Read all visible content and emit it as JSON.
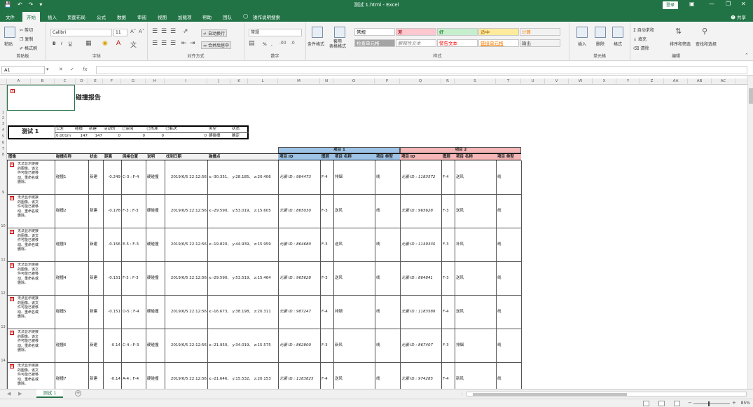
{
  "titlebar": {
    "title": "测试 1.html  -  Excel",
    "login": "登录",
    "undo_icon": "undo-icon",
    "redo_icon": "redo-icon",
    "save_icon": "save-icon"
  },
  "tabs": {
    "items": [
      "文件",
      "开始",
      "插入",
      "页面布局",
      "公式",
      "数据",
      "审阅",
      "视图",
      "加载项",
      "帮助",
      "团队"
    ],
    "tell_me": "操作说明搜索",
    "share": "共享"
  },
  "ribbon": {
    "clipboard": {
      "paste": "粘贴",
      "cut": "剪切",
      "copy": "复制",
      "format_painter": "格式刷",
      "label": "剪贴板"
    },
    "font": {
      "name": "Calibri",
      "size": "11",
      "label": "字体",
      "bold": "B",
      "italic": "I",
      "underline": "U"
    },
    "align": {
      "wrap": "自动换行",
      "merge": "合并后居中",
      "label": "对齐方式"
    },
    "number": {
      "format": "常规",
      "percent": "%",
      "comma": ",",
      "label": "数字"
    },
    "styles": {
      "conditional": "条件格式",
      "table": "套用\n表格格式",
      "label": "样式",
      "cells": [
        {
          "text": "常规",
          "bg": "#ffffff",
          "color": "#000000"
        },
        {
          "text": "差",
          "bg": "#ffc7ce",
          "color": "#9c0006"
        },
        {
          "text": "好",
          "bg": "#c6efce",
          "color": "#006100"
        },
        {
          "text": "适中",
          "bg": "#ffeb9c",
          "color": "#9c5700"
        },
        {
          "text": "计算",
          "bg": "#f2f2f2",
          "color": "#fa7d00"
        },
        {
          "text": "检查单元格",
          "bg": "#a5a5a5",
          "color": "#ffffff"
        },
        {
          "text": "解释性文本",
          "bg": "#ffffff",
          "color": "#7f7f7f"
        },
        {
          "text": "警告文本",
          "bg": "#ffffff",
          "color": "#ff0000"
        },
        {
          "text": "链接单元格",
          "bg": "#ffffff",
          "color": "#fa7d00"
        },
        {
          "text": "输出",
          "bg": "#f2f2f2",
          "color": "#3f3f3f"
        }
      ]
    },
    "cells_group": {
      "insert": "插入",
      "delete": "删除",
      "format": "格式",
      "label": "单元格"
    },
    "editing": {
      "autosum": "自动求和",
      "fill": "填充",
      "clear": "清除",
      "sort": "排序和筛选",
      "find": "查找和选择",
      "label": "编辑"
    }
  },
  "formula_bar": {
    "namebox": "A1",
    "fx": "fx",
    "value": ""
  },
  "columns": [
    "A",
    "B",
    "C",
    "D",
    "E",
    "F",
    "G",
    "H",
    "I",
    "J",
    "K",
    "L",
    "M",
    "N",
    "O",
    "P",
    "Q",
    "R",
    "S",
    "T",
    "U",
    "V",
    "W",
    "X",
    "Y",
    "Z",
    "AA",
    "AB",
    "AC"
  ],
  "rows": [
    "1",
    "2",
    "3",
    "4",
    "5",
    "6",
    "7",
    "8",
    "9",
    "10",
    "11",
    "12",
    "13",
    "14"
  ],
  "sheet": {
    "report_title": "碰撞报告",
    "summary": {
      "name": "测试 1",
      "headers": [
        "公差",
        "碰撞",
        "新建",
        "活动的",
        "已审阅",
        "已核准",
        "已解决",
        "类型",
        "状态"
      ],
      "values": [
        "0.001m",
        "147",
        "147",
        "0",
        "0",
        "0",
        "0",
        "硬碰撞",
        "确定"
      ]
    },
    "item1_title": "项目 1",
    "item2_title": "项目 2",
    "table_headers": [
      "图像",
      "碰撞名称",
      "状态",
      "距离",
      "网格位置",
      "说明",
      "找到日期",
      "碰撞点",
      "项目 ID",
      "图层",
      "项目 名称",
      "项目 类型",
      "项目 ID",
      "图层",
      "项目 名称",
      "项目 类型"
    ],
    "broken_image_text": "无法显示链接的图像。该文件可能已被移动、重命名或删除。",
    "rows": [
      [
        "碰撞1",
        "新建",
        "-0.249",
        "C-3 : F-4",
        "硬碰撞",
        "2019/6/5  22:12:56",
        "x:-30.351、 y:28.185、 z:20.406",
        "元素 ID : 984473",
        "F-4",
        "排烟",
        "线",
        "元素 ID : 1183572",
        "F-4",
        "送风",
        "线"
      ],
      [
        "碰撞2",
        "新建",
        "-0.178",
        "F-3 : F-3",
        "硬碰撞",
        "2019/6/5  22:12:56",
        "x:-29.590、 y:53.019、 z:15.605",
        "元素 ID : 865030",
        "F-3",
        "送风",
        "线",
        "元素 ID : 965628",
        "F-3",
        "送风",
        "线"
      ],
      [
        "碰撞3",
        "新建",
        "-0.156",
        "E-5 : F-3",
        "硬碰撞",
        "2019/6/5  22:12:56",
        "x:-19.820、 y:44.939、 z:15.959",
        "元素 ID : 864680",
        "F-3",
        "送风",
        "线",
        "元素 ID : 1149330",
        "F-3",
        "补风",
        "线"
      ],
      [
        "碰撞4",
        "新建",
        "-0.151",
        "F-3 : F-3",
        "硬碰撞",
        "2019/6/5  22:12:56",
        "x:-29.590、 y:53.519、 z:15.464",
        "元素 ID : 965628",
        "F-3",
        "送风",
        "线",
        "元素 ID : 864841",
        "F-3",
        "送风",
        "线"
      ],
      [
        "碰撞5",
        "新建",
        "-0.151",
        "D-5 : F-4",
        "硬碰撞",
        "2019/6/5  22:12:56",
        "x:-16.673、 y:38.198、 z:20.311",
        "元素 ID : 987247",
        "F-4",
        "排烟",
        "线",
        "元素 ID : 1183588",
        "F-4",
        "送风",
        "线"
      ],
      [
        "碰撞6",
        "新建",
        "-0.14",
        "C-4 : F-3",
        "硬碰撞",
        "2019/6/5  22:12:56",
        "x:-21.950、 y:34.019、 z:15.575",
        "元素 ID : 862800",
        "F-3",
        "新风",
        "线",
        "元素 ID : 867407",
        "F-3",
        "排烟",
        "线"
      ],
      [
        "碰撞7",
        "新建",
        "-0.14",
        "A-4 : F-4",
        "硬碰撞",
        "2019/6/5  22:12:56",
        "x:-21.646、 y:15.532、 z:20.153",
        "元素 ID : 1183825",
        "F-4",
        "送风",
        "线",
        "元素 ID : 974285",
        "F-4",
        "新风",
        "线"
      ]
    ]
  },
  "sheet_tab": "测试 1",
  "status": {
    "zoom": "85%"
  }
}
